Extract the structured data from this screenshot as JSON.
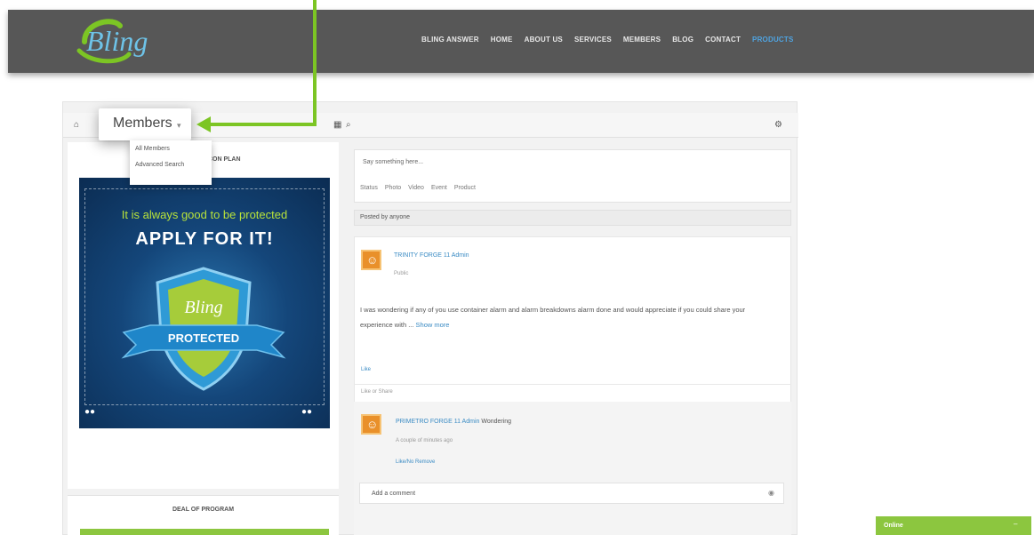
{
  "header": {
    "logo_text": "Bling",
    "nav": [
      "BLING ANSWER",
      "HOME",
      "ABOUT US",
      "SERVICES",
      "MEMBERS",
      "BLOG",
      "CONTACT",
      "PRODUCTS"
    ],
    "active_nav_index": 7
  },
  "colors": {
    "header_bg": "#575757",
    "accent_green": "#7cc524",
    "link_blue": "#3a8bc4"
  },
  "toolbar": {
    "members_label": "Members",
    "members_menu": [
      "All Members",
      "Advanced Search"
    ]
  },
  "left": {
    "column_title": "ICON PLAN",
    "promo": {
      "line1": "It is always good to be protected",
      "line2": "APPLY FOR IT!",
      "badge_logo": "Bling",
      "badge_text": "PROTECTED"
    },
    "side_box_title": "DEAL OF PROGRAM"
  },
  "right": {
    "post_placeholder": "Say something here...",
    "post_actions": [
      "Status",
      "Photo",
      "Video",
      "Event",
      "Product"
    ],
    "filter_label": "Posted by anyone",
    "feed_item": {
      "author": "TRINITY FORGE 11 Admin",
      "meta": "Public",
      "body": "I was wondering if any of you use container alarm and alarm breakdowns alarm done and would appreciate if you could share your experience with ...",
      "more_label": "Show more",
      "link1": "Like",
      "link2": "Like or Share"
    },
    "comment": {
      "author": "PRIMETRO FORGE 11 Admin",
      "text": "Wondering",
      "meta": "A couple of minutes ago",
      "link": "Like/No Remove"
    },
    "add_comment_label": "Add a comment"
  },
  "chat": {
    "label": "Online",
    "toggle": "–"
  }
}
